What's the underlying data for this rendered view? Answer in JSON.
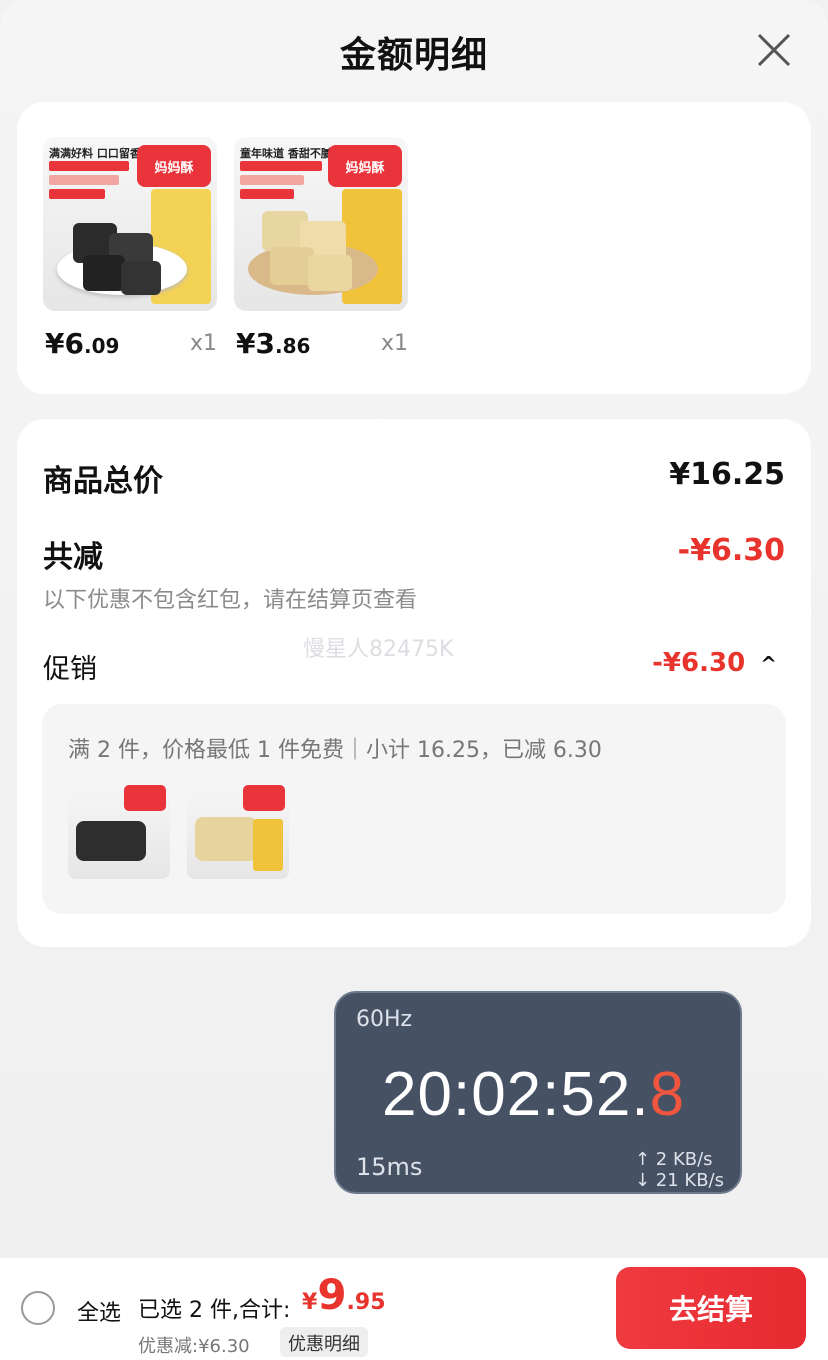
{
  "header": {
    "title": "金额明细",
    "close_icon": "close-icon"
  },
  "products": [
    {
      "tagline": "满满好料 口口留香",
      "logo_text": "妈妈酥",
      "price_int": "¥6",
      "price_dec": ".09",
      "qty": "x1"
    },
    {
      "tagline": "童年味道 香甜不腻",
      "logo_text": "妈妈酥",
      "price_int": "¥3",
      "price_dec": ".86",
      "qty": "x1"
    }
  ],
  "summary": {
    "total_label": "商品总价",
    "total_value": "¥16.25",
    "discount_label": "共减",
    "discount_value": "-¥6.30",
    "discount_note": "以下优惠不包含红包，请在结算页查看",
    "promo_label": "促销",
    "promo_value": "-¥6.30",
    "promo_toggle": "^",
    "watermark": "慢星人82475K"
  },
  "promo_box": {
    "text": "满 2 件，价格最低 1 件免费｜小计 16.25，已减 6.30"
  },
  "overlay": {
    "refresh": "60Hz",
    "time_main": "20:02:52.",
    "time_frac": "8",
    "latency": "15ms",
    "upload": "↑ 2 KB/s",
    "download": "↓ 21 KB/s"
  },
  "bottom": {
    "select_all": "全选",
    "selected": "已选 2 件,合计:",
    "total_currency": "¥",
    "total_int": "9",
    "total_dec": ".95",
    "savings": "优惠减:¥6.30",
    "detail_button": "优惠明细",
    "checkout_button": "去结算"
  },
  "colors": {
    "accent_red": "#e8342c",
    "overlay_bg": "#465264"
  }
}
